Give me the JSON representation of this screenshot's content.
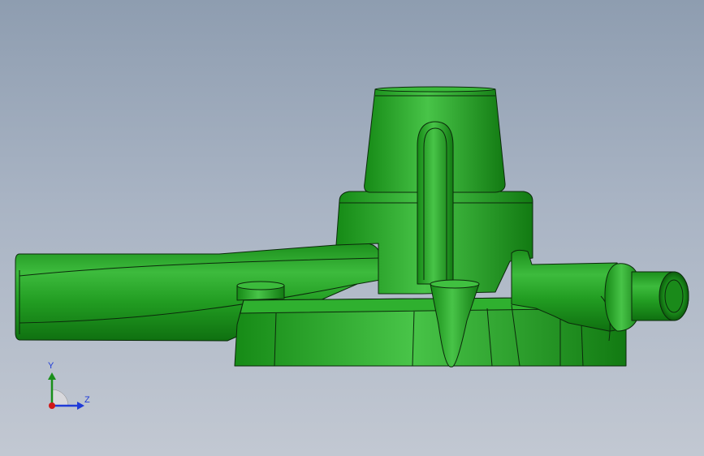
{
  "viewport": {
    "background_top": "#8e9db0",
    "background_bottom": "#c2c8d2"
  },
  "model": {
    "part_color": "#1f9a1f",
    "highlight_color": "#48c048",
    "shadow_color": "#0f6b12",
    "edge_color": "#0b2a0b"
  },
  "triad": {
    "y_label": "Y",
    "z_label": "Z",
    "y_color": "#1a8f1a",
    "z_color": "#1f3bd8",
    "x_color": "#d01818"
  }
}
